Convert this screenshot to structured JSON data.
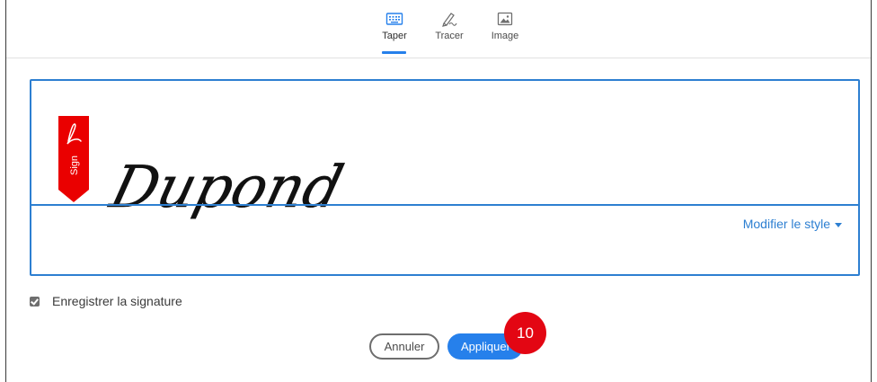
{
  "tabs": [
    {
      "label": "Taper",
      "icon": "keyboard-icon",
      "active": true
    },
    {
      "label": "Tracer",
      "icon": "pen-draw-icon",
      "active": false
    },
    {
      "label": "Image",
      "icon": "image-icon",
      "active": false
    }
  ],
  "signature": {
    "text": "Dupond",
    "ribbon_label": "Sign",
    "ribbon_color": "#ea0000",
    "modify_style_label": "Modifier le style"
  },
  "save": {
    "label": "Enregistrer la signature",
    "checked": true
  },
  "buttons": {
    "cancel_label": "Annuler",
    "apply_label": "Appliquer"
  },
  "step_badge": "10",
  "colors": {
    "accent": "#2680eb",
    "badge": "#e30613"
  }
}
